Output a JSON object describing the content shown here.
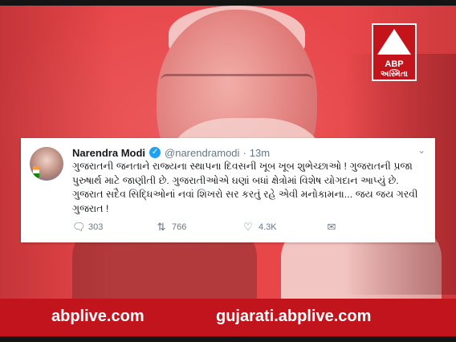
{
  "logo": {
    "brand": "ABP",
    "channel": "અસ્મિતા"
  },
  "tweet": {
    "author": "Narendra Modi",
    "handle": "@narendramodi",
    "separator": "·",
    "time": "13m",
    "text": "ગુજરાતની જનતાને રાજ્યના સ્થાપના દિવસની ખૂબ ખૂબ શુભેચ્છાઓ ! ગુજરાતની પ્રજા પુરુષાર્થ માટે જાણીતી છે. ગુજરાતીઓએ ઘણાં બધાં ક્ષેત્રોમાં વિશેષ યોગદાન આપ્યું છે. ગુજરાત સદૈવ સિદ્ધિઓનાં નવાં શિખરો સર કરતું રહે એવી મનોકામના... જય જય ગરવી ગુજરાત !",
    "replies": "303",
    "retweets": "766",
    "likes": "4.3K"
  },
  "footer": {
    "left_url": "abplive.com",
    "right_url": "gujarati.abplive.com"
  },
  "colors": {
    "background": "#e8474a",
    "banner": "#c1141c",
    "verified": "#1da1f2"
  }
}
